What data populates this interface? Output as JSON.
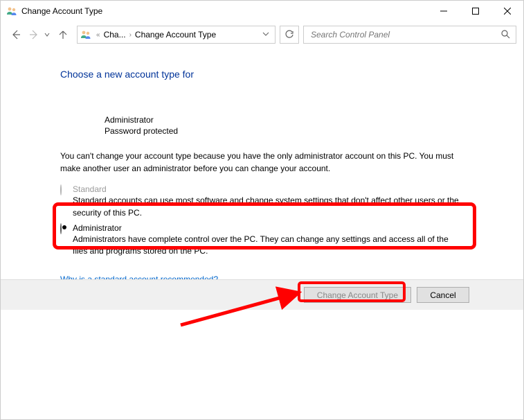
{
  "window": {
    "title": "Change Account Type"
  },
  "breadcrumb": {
    "item1": "Cha...",
    "item2": "Change Account Type"
  },
  "search": {
    "placeholder": "Search Control Panel"
  },
  "page": {
    "heading": "Choose a new account type for",
    "user": {
      "name": "Administrator",
      "status": "Password protected"
    },
    "explanation": "You can't change your account type because you have the only administrator account on this PC. You must make another user an administrator before you can change your account.",
    "options": {
      "standard": {
        "label": "Standard",
        "desc": "Standard accounts can use most software and change system settings that don't affect other users or the security of this PC."
      },
      "administrator": {
        "label": "Administrator",
        "desc": "Administrators have complete control over the PC. They can change any settings and access all of the files and programs stored on the PC."
      }
    },
    "help_link": "Why is a standard account recommended?"
  },
  "buttons": {
    "change": "Change Account Type",
    "cancel": "Cancel"
  }
}
